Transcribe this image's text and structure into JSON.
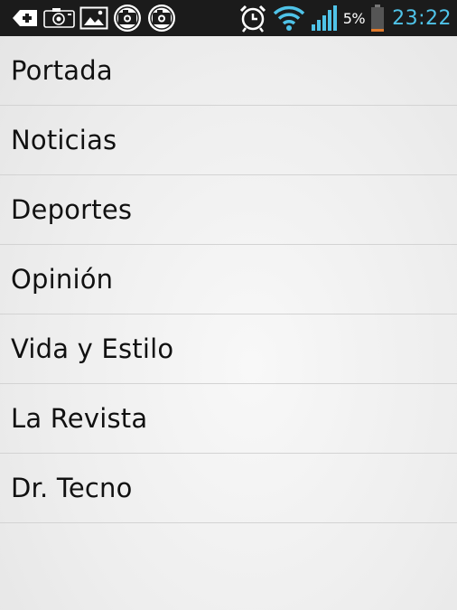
{
  "status_bar": {
    "notification_icons": [
      "medical-cross-icon",
      "camera-icon",
      "image-icon",
      "photo-sync-icon",
      "photo-sync-icon"
    ],
    "system_icons": [
      "alarm-clock-icon",
      "wifi-icon",
      "signal-bars-icon"
    ],
    "battery_percent": "5%",
    "time": "23:22",
    "clock_color": "#4fc3e8",
    "battery_low_color": "#e07a2c"
  },
  "menu": {
    "items": [
      {
        "label": "Portada"
      },
      {
        "label": "Noticias"
      },
      {
        "label": "Deportes"
      },
      {
        "label": "Opinión"
      },
      {
        "label": "Vida y Estilo"
      },
      {
        "label": "La Revista"
      },
      {
        "label": "Dr. Tecno"
      }
    ]
  }
}
